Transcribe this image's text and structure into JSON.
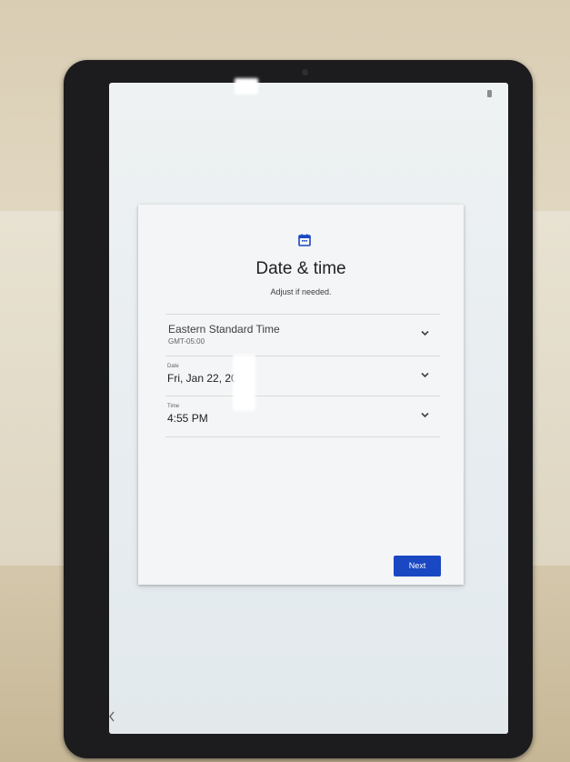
{
  "setup": {
    "icon": "calendar-icon",
    "title": "Date & time",
    "subtitle": "Adjust if needed.",
    "timezone": {
      "name": "Eastern Standard Time",
      "offset": "GMT-05:00"
    },
    "date": {
      "label": "Date",
      "value": "Fri, Jan 22, 20"
    },
    "time": {
      "label": "Time",
      "value": "4:55 PM"
    },
    "next_label": "Next"
  },
  "nav": {
    "back_icon": "back-arrow-icon"
  },
  "colors": {
    "accent": "#1a47c2",
    "card_bg": "#f4f5f6",
    "screen_bg": "#eef2f3"
  }
}
